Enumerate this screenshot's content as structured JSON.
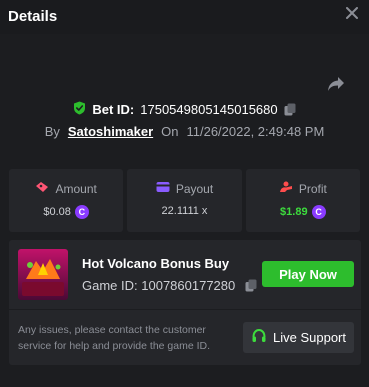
{
  "header": {
    "title": "Details"
  },
  "bet": {
    "id_label": "Bet ID:",
    "id_value": "1750549805145015680",
    "by_label": "By",
    "username": "Satoshimaker",
    "on_label": "On",
    "datetime": "11/26/2022, 2:49:48 PM"
  },
  "stats": {
    "amount": {
      "label": "Amount",
      "value": "$0.08"
    },
    "payout": {
      "label": "Payout",
      "value": "22.1111 x"
    },
    "profit": {
      "label": "Profit",
      "value": "$1.89"
    }
  },
  "game": {
    "name": "Hot Volcano Bonus Buy",
    "thumb_text": "HOT VOLCANO\nBONUS BUY",
    "id_label": "Game ID:",
    "id_value": "1007860177280",
    "play_label": "Play Now",
    "help_text": "Any issues, please contact the customer service for help and provide the game ID.",
    "support_label": "Live Support"
  },
  "colors": {
    "accent_green": "#2dbd2d",
    "profit_green": "#3ddc3d",
    "coin_purple": "#8a3bff"
  }
}
